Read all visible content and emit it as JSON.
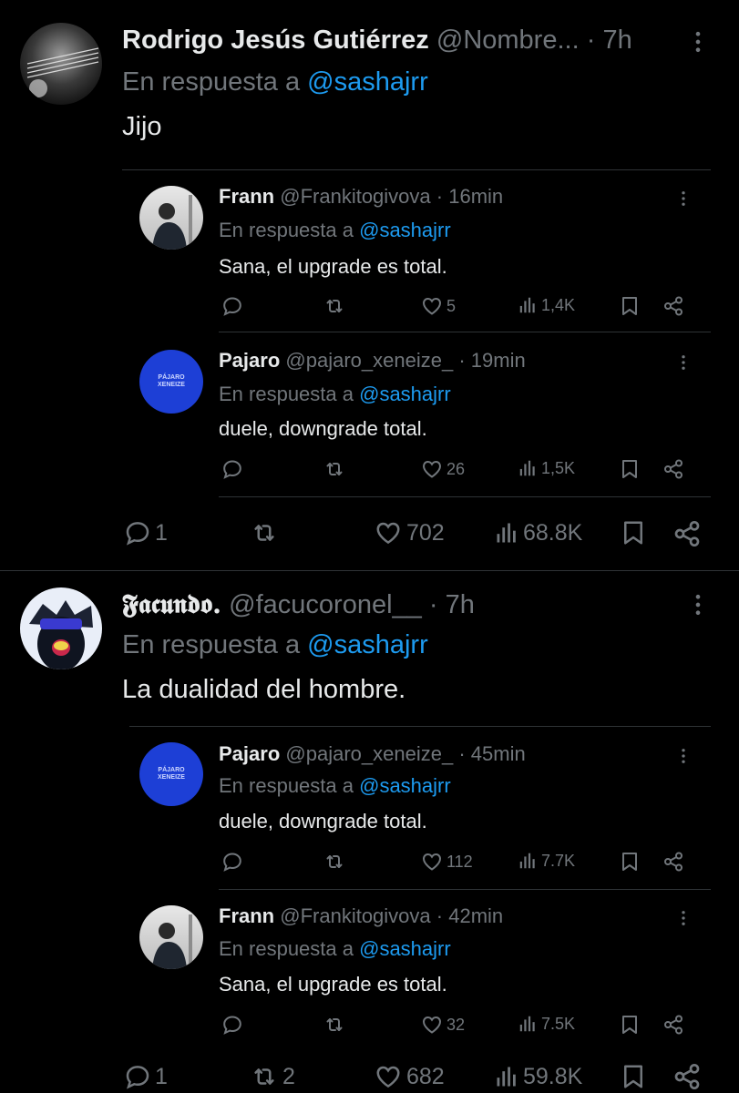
{
  "thread1": {
    "author": {
      "name": "Rodrigo Jesús Gutiérrez",
      "handle": "@Nombre...",
      "dot": "·",
      "time": "7h"
    },
    "reply_prefix": "En respuesta a",
    "reply_to": "@sashajrr",
    "text": "Jijo",
    "quoted": [
      {
        "name": "Frann",
        "handle": "@Frankitogivova",
        "dot": "·",
        "time": "16min",
        "reply_prefix": "En respuesta a",
        "reply_to": "@sashajrr",
        "text": "Sana, el upgrade es total.",
        "likes": "5",
        "views": "1,4K"
      },
      {
        "name": "Pajaro",
        "handle": "@pajaro_xeneize_",
        "dot": "·",
        "time": "19min",
        "reply_prefix": "En respuesta a",
        "reply_to": "@sashajrr",
        "text": "duele, downgrade total.",
        "likes": "26",
        "views": "1,5K",
        "avatar_text": "PÁJARO XENEIZE"
      }
    ],
    "stats": {
      "replies": "1",
      "retweets": "",
      "likes": "702",
      "views": "68.8K"
    }
  },
  "thread2": {
    "author": {
      "name": "𝕱𝖆𝖈𝖚𝖓𝖉𝖔.",
      "handle": "@facucoronel__",
      "dot": "·",
      "time": "7h"
    },
    "reply_prefix": "En respuesta a",
    "reply_to": "@sashajrr",
    "text": "La dualidad del hombre.",
    "quoted": [
      {
        "name": "Pajaro",
        "handle": "@pajaro_xeneize_",
        "dot": "·",
        "time": "45min",
        "reply_prefix": "En respuesta a",
        "reply_to": "@sashajrr",
        "text": "duele, downgrade total.",
        "likes": "112",
        "views": "7.7K",
        "avatar_text": "PÁJARO XENEIZE"
      },
      {
        "name": "Frann",
        "handle": "@Frankitogivova",
        "dot": "·",
        "time": "42min",
        "reply_prefix": "En respuesta a",
        "reply_to": "@sashajrr",
        "text": "Sana, el upgrade es total.",
        "likes": "32",
        "views": "7.5K"
      }
    ],
    "stats": {
      "replies": "1",
      "retweets": "2",
      "likes": "682",
      "views": "59.8K"
    }
  },
  "colors": {
    "background": "#000000",
    "text": "#e7e9ea",
    "muted": "#71767b",
    "link": "#1d9bf0",
    "divider": "#2f3336",
    "pajaro_avatar": "#1d3fd6"
  }
}
